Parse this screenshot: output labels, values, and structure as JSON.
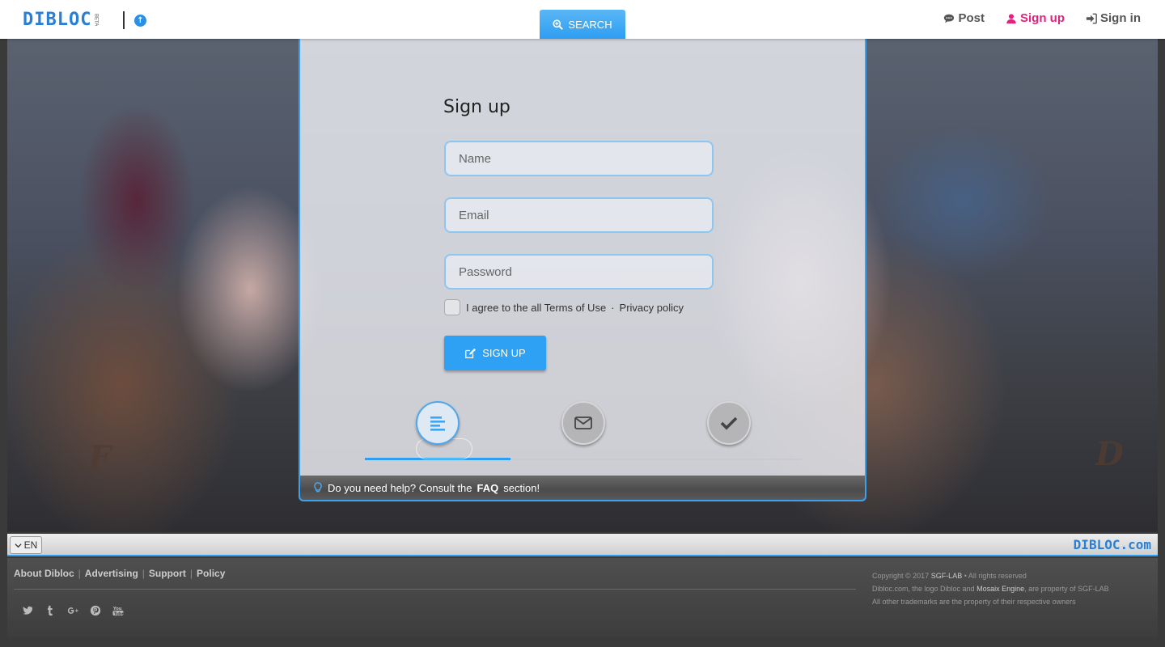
{
  "header": {
    "logo_text": "DIBLOC",
    "logo_badge": "BETA",
    "search_label": "SEARCH",
    "nav": {
      "post": "Post",
      "signup": "Sign up",
      "signin": "Sign in"
    }
  },
  "form": {
    "title": "Sign up",
    "name_placeholder": "Name",
    "email_placeholder": "Email",
    "password_placeholder": "Password",
    "terms_prefix": "I agree to the all Terms of Use",
    "terms_dot": "·",
    "privacy": "Privacy policy",
    "submit_label": "SIGN UP"
  },
  "steps": {
    "count": 3,
    "active": 1,
    "progress": 0.333
  },
  "help": {
    "prefix": "Do you need help? Consult the",
    "faq": "FAQ",
    "suffix": "section!"
  },
  "footer": {
    "lang": "EN",
    "logo": "DIBLOC.com",
    "links": [
      "About Dibloc",
      "Advertising",
      "Support",
      "Policy"
    ],
    "legal": {
      "copyright_prefix": "Copyright © 2017",
      "company": "SGF-LAB",
      "copyright_suffix": "• All rights reserved",
      "line2_a": "Dibloc.com, the logo Dibloc and",
      "engine": "Mosaix Engine",
      "line2_b": ", are property of SGF-LAB",
      "line3": "All other trademarks are the property of their respective owners"
    }
  },
  "colors": {
    "accent": "#2e9ef2",
    "signup": "#e0237c"
  }
}
